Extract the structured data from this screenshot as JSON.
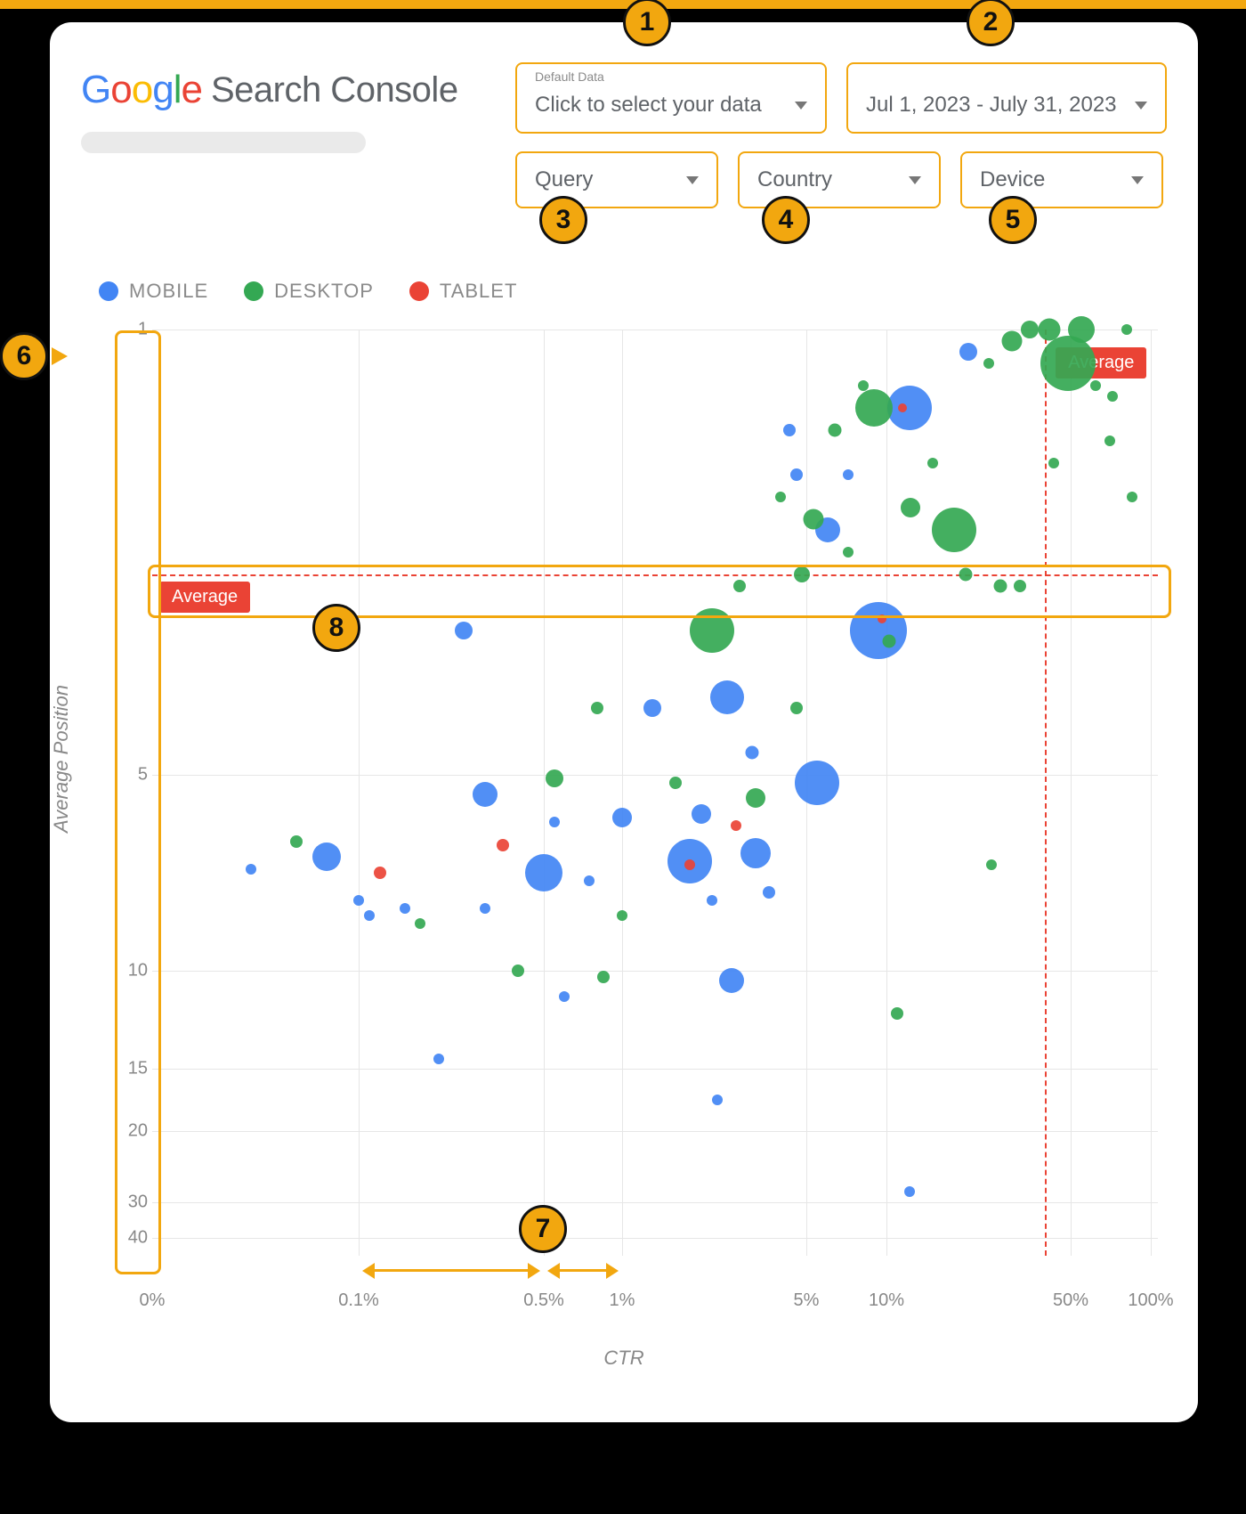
{
  "brand": {
    "part_g": "G",
    "part_o1": "o",
    "part_o2": "o",
    "part_g2": "g",
    "part_l": "l",
    "part_e": "e",
    "title": "Search Console"
  },
  "filters": {
    "data": {
      "small": "Default Data",
      "label": "Click to select your data"
    },
    "date": {
      "label": "Jul 1, 2023 - July 31, 2023"
    },
    "query": {
      "label": "Query"
    },
    "country": {
      "label": "Country"
    },
    "device": {
      "label": "Device"
    }
  },
  "legend": {
    "mobile": "MOBILE",
    "desktop": "DESKTOP",
    "tablet": "TABLET"
  },
  "axes": {
    "ylabel": "Average Position",
    "xlabel": "CTR"
  },
  "average_label": "Average",
  "callouts": {
    "c1": "1",
    "c2": "2",
    "c3": "3",
    "c4": "4",
    "c5": "5",
    "c6": "6",
    "c7": "7",
    "c8": "8"
  },
  "chart_data": {
    "type": "scatter",
    "xlabel": "CTR",
    "ylabel": "Average Position",
    "x_scale": "log",
    "x_ticks": [
      "0%",
      "0.1%",
      "0.5%",
      "1%",
      "5%",
      "10%",
      "50%",
      "100%"
    ],
    "y_ticks": [
      1,
      5,
      10,
      15,
      20,
      30,
      40
    ],
    "y_reversed": true,
    "annotations": {
      "avg_label": "Average",
      "avg_ctr": 40,
      "avg_position": 3.2
    },
    "series": [
      {
        "name": "MOBILE",
        "color": "#4285F4",
        "points": [
          {
            "ctr": 0.03,
            "pos": 7.4,
            "size": 1.2
          },
          {
            "ctr": 0.07,
            "pos": 7.1,
            "size": 3.2
          },
          {
            "ctr": 0.1,
            "pos": 8.2,
            "size": 1.2
          },
          {
            "ctr": 0.11,
            "pos": 8.6,
            "size": 1.2
          },
          {
            "ctr": 0.15,
            "pos": 8.4,
            "size": 1.2
          },
          {
            "ctr": 0.2,
            "pos": 14.5,
            "size": 1.2
          },
          {
            "ctr": 0.25,
            "pos": 3.7,
            "size": 2.0
          },
          {
            "ctr": 0.3,
            "pos": 5.5,
            "size": 2.8
          },
          {
            "ctr": 0.3,
            "pos": 8.4,
            "size": 1.2
          },
          {
            "ctr": 0.5,
            "pos": 7.5,
            "size": 4.2
          },
          {
            "ctr": 0.55,
            "pos": 6.2,
            "size": 1.2
          },
          {
            "ctr": 0.6,
            "pos": 11.3,
            "size": 1.2
          },
          {
            "ctr": 0.75,
            "pos": 7.7,
            "size": 1.2
          },
          {
            "ctr": 1.0,
            "pos": 6.1,
            "size": 2.2
          },
          {
            "ctr": 1.3,
            "pos": 4.4,
            "size": 2.0
          },
          {
            "ctr": 1.8,
            "pos": 7.2,
            "size": 5.0
          },
          {
            "ctr": 2.0,
            "pos": 6.0,
            "size": 2.2
          },
          {
            "ctr": 2.2,
            "pos": 8.2,
            "size": 1.2
          },
          {
            "ctr": 2.3,
            "pos": 17.5,
            "size": 1.2
          },
          {
            "ctr": 2.5,
            "pos": 4.3,
            "size": 3.8
          },
          {
            "ctr": 2.6,
            "pos": 10.5,
            "size": 2.8
          },
          {
            "ctr": 3.1,
            "pos": 4.8,
            "size": 1.5
          },
          {
            "ctr": 3.2,
            "pos": 7.0,
            "size": 3.4
          },
          {
            "ctr": 3.6,
            "pos": 8.0,
            "size": 1.4
          },
          {
            "ctr": 4.3,
            "pos": 1.9,
            "size": 1.4
          },
          {
            "ctr": 4.6,
            "pos": 2.3,
            "size": 1.4
          },
          {
            "ctr": 5.5,
            "pos": 5.2,
            "size": 5.0
          },
          {
            "ctr": 6.0,
            "pos": 2.8,
            "size": 2.8
          },
          {
            "ctr": 7.2,
            "pos": 2.3,
            "size": 1.2
          },
          {
            "ctr": 9.3,
            "pos": 3.7,
            "size": 6.4
          },
          {
            "ctr": 12.2,
            "pos": 1.7,
            "size": 5.0
          },
          {
            "ctr": 12.2,
            "pos": 28.5,
            "size": 1.2
          },
          {
            "ctr": 20.5,
            "pos": 1.2,
            "size": 2.0
          }
        ]
      },
      {
        "name": "DESKTOP",
        "color": "#34A853",
        "points": [
          {
            "ctr": 0.05,
            "pos": 6.7,
            "size": 1.4
          },
          {
            "ctr": 0.17,
            "pos": 8.8,
            "size": 1.2
          },
          {
            "ctr": 0.4,
            "pos": 10.0,
            "size": 1.4
          },
          {
            "ctr": 0.55,
            "pos": 5.1,
            "size": 2.0
          },
          {
            "ctr": 0.8,
            "pos": 4.4,
            "size": 1.4
          },
          {
            "ctr": 0.85,
            "pos": 10.3,
            "size": 1.4
          },
          {
            "ctr": 1.0,
            "pos": 8.6,
            "size": 1.2
          },
          {
            "ctr": 1.6,
            "pos": 5.2,
            "size": 1.4
          },
          {
            "ctr": 2.2,
            "pos": 3.7,
            "size": 5.0
          },
          {
            "ctr": 2.8,
            "pos": 3.3,
            "size": 1.4
          },
          {
            "ctr": 3.2,
            "pos": 5.6,
            "size": 2.2
          },
          {
            "ctr": 4.0,
            "pos": 2.5,
            "size": 1.2
          },
          {
            "ctr": 4.6,
            "pos": 4.4,
            "size": 1.4
          },
          {
            "ctr": 4.8,
            "pos": 3.2,
            "size": 1.8
          },
          {
            "ctr": 5.3,
            "pos": 2.7,
            "size": 2.3
          },
          {
            "ctr": 6.4,
            "pos": 1.9,
            "size": 1.5
          },
          {
            "ctr": 7.2,
            "pos": 3.0,
            "size": 1.2
          },
          {
            "ctr": 8.2,
            "pos": 1.5,
            "size": 1.2
          },
          {
            "ctr": 9.0,
            "pos": 1.7,
            "size": 4.2
          },
          {
            "ctr": 10.2,
            "pos": 3.8,
            "size": 1.5
          },
          {
            "ctr": 11.0,
            "pos": 12.2,
            "size": 1.4
          },
          {
            "ctr": 12.3,
            "pos": 2.6,
            "size": 2.2
          },
          {
            "ctr": 15.0,
            "pos": 2.2,
            "size": 1.2
          },
          {
            "ctr": 18.0,
            "pos": 2.8,
            "size": 5.0
          },
          {
            "ctr": 20.0,
            "pos": 3.2,
            "size": 1.5
          },
          {
            "ctr": 24.5,
            "pos": 1.3,
            "size": 1.2
          },
          {
            "ctr": 25.0,
            "pos": 7.3,
            "size": 1.2
          },
          {
            "ctr": 27.0,
            "pos": 3.3,
            "size": 1.5
          },
          {
            "ctr": 30.0,
            "pos": 1.1,
            "size": 2.3
          },
          {
            "ctr": 32.0,
            "pos": 3.3,
            "size": 1.4
          },
          {
            "ctr": 35.0,
            "pos": 1.0,
            "size": 2.0
          },
          {
            "ctr": 41.5,
            "pos": 1.0,
            "size": 2.5
          },
          {
            "ctr": 43.0,
            "pos": 2.2,
            "size": 1.2
          },
          {
            "ctr": 49.0,
            "pos": 1.3,
            "size": 6.2
          },
          {
            "ctr": 55.0,
            "pos": 1.0,
            "size": 3.0
          },
          {
            "ctr": 62.0,
            "pos": 1.5,
            "size": 1.2
          },
          {
            "ctr": 70.0,
            "pos": 2.0,
            "size": 1.2
          },
          {
            "ctr": 72.0,
            "pos": 1.6,
            "size": 1.2
          },
          {
            "ctr": 81.0,
            "pos": 1.0,
            "size": 1.2
          },
          {
            "ctr": 85.0,
            "pos": 2.5,
            "size": 1.2
          }
        ]
      },
      {
        "name": "TABLET",
        "color": "#EA4335",
        "points": [
          {
            "ctr": 0.12,
            "pos": 7.5,
            "size": 1.4
          },
          {
            "ctr": 0.35,
            "pos": 6.8,
            "size": 1.4
          },
          {
            "ctr": 1.8,
            "pos": 7.3,
            "size": 1.2
          },
          {
            "ctr": 2.7,
            "pos": 6.3,
            "size": 1.2
          },
          {
            "ctr": 9.6,
            "pos": 3.6,
            "size": 1.0
          },
          {
            "ctr": 11.5,
            "pos": 1.7,
            "size": 1.0
          }
        ]
      }
    ]
  }
}
